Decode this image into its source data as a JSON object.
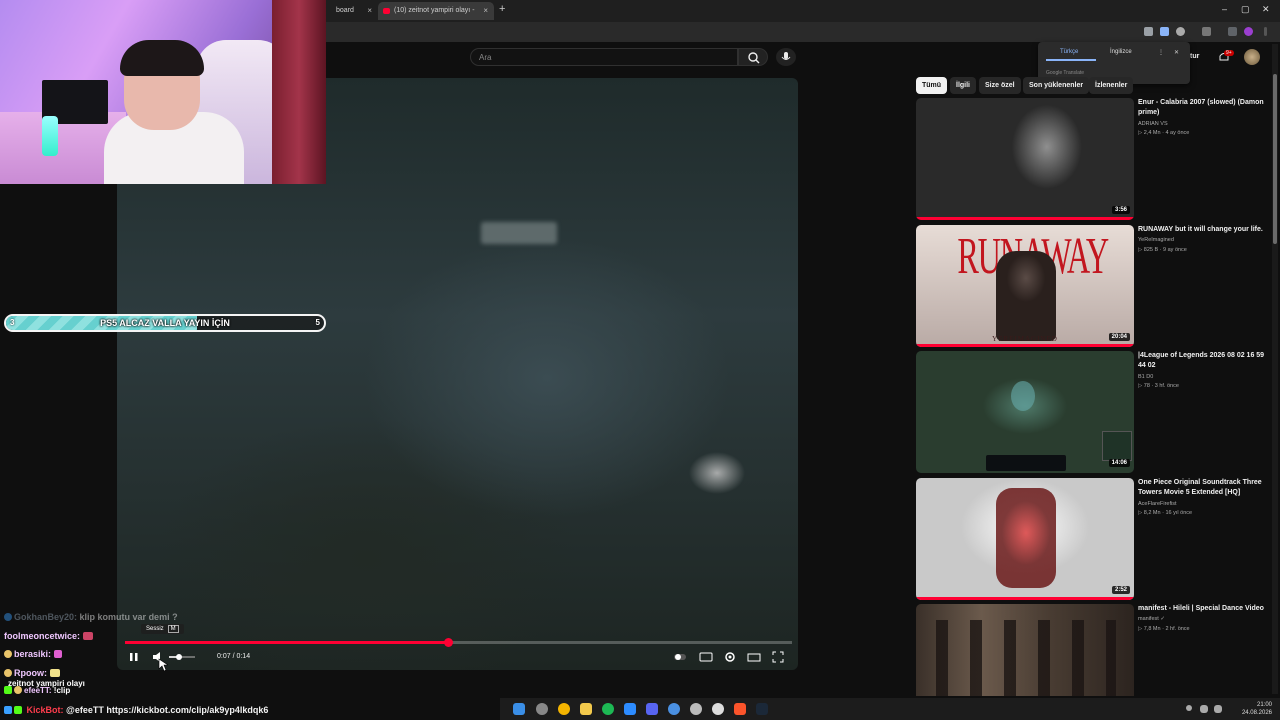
{
  "browser": {
    "tabs": [
      {
        "label": "board"
      },
      {
        "label": "(10) zeitnot yampiri olayı -"
      }
    ],
    "new_tab": "+",
    "close": "×",
    "window_controls": [
      "–",
      "▢",
      "✕"
    ]
  },
  "youtube": {
    "search_placeholder": "Ara",
    "header_right_partial": "tur",
    "notification_count": "9+"
  },
  "translate_popup": {
    "lang_source": "Türkçe",
    "lang_target": "İngilizce",
    "footer": "Google Translate"
  },
  "player": {
    "tooltip": "Sessiz",
    "tooltip_key": "M",
    "time": "0:07 / 0:14",
    "progress": 0.485
  },
  "chips": [
    "Tümü",
    "İlgili",
    "Size özel",
    "Son yüklenenler",
    "İzlenenler"
  ],
  "recommendations": [
    {
      "title": "Enur - Calabria 2007 (slowed) (Damon prime)",
      "channel": "ADRIAN VS",
      "meta": "▷ 2,4 Mn · 4 ay önce",
      "duration": "3:56",
      "icon": "damon-portrait"
    },
    {
      "title": "RUNAWAY but it will change your life.",
      "channel": "YeReImagined",
      "meta": "▷ 825 B · 9 ay önce",
      "duration": "20:04",
      "icon": "runaway-cover",
      "thumb_text": "RUNAWAY",
      "thumb_sub": "YEREIMAGINED"
    },
    {
      "title": "|4League of Legends 2026 08 02   16 59 44 02",
      "channel": "B1 D0",
      "meta": "▷ 78 · 3 hf. önce",
      "duration": "14:06",
      "icon": "league-gameplay"
    },
    {
      "title": "One Piece Original Soundtrack Three Towers Movie 5 Extended [HQ]",
      "channel": "AceFlareFirefist",
      "meta": "▷ 8,2 Mn · 16 yıl önce",
      "duration": "2:52",
      "icon": "luffy-art"
    },
    {
      "title": "manifest - Hileli | Special Dance Video",
      "channel": "manifest ✓",
      "meta": "▷ 7,8 Mn · 2 hf. önce",
      "duration": "",
      "icon": "dance-group"
    }
  ],
  "goal": {
    "left": "3",
    "text": "PS5 ALCAZ VALLA YAYIN İÇİN",
    "right": "5",
    "progress": 0.6
  },
  "chat": [
    {
      "user": "GokhanBey20:",
      "msg": "klip komutu var demi ?",
      "faded": true
    },
    {
      "user": "foolmeoncetwice:",
      "msg": "",
      "faded": false
    },
    {
      "user": "berasiki:",
      "msg": "",
      "faded": false
    },
    {
      "user": "Rpoow:",
      "msg": "",
      "faded": false
    },
    {
      "user": "",
      "msg": "zeitnot yampiri olayı",
      "faded": false
    },
    {
      "user": "efeeTT:",
      "msg": "!clip",
      "faded": false
    }
  ],
  "kickbot": {
    "name": "KickBot:",
    "msg": "@efeeTT https://kickbot.com/clip/ak9yp4lkdqk6"
  },
  "clock": {
    "time": "21:00",
    "date": "24.08.2026"
  },
  "colors": {
    "accent": "#ff0033",
    "goal": "#66d0cf",
    "chip_active": "#f1f1f1"
  }
}
